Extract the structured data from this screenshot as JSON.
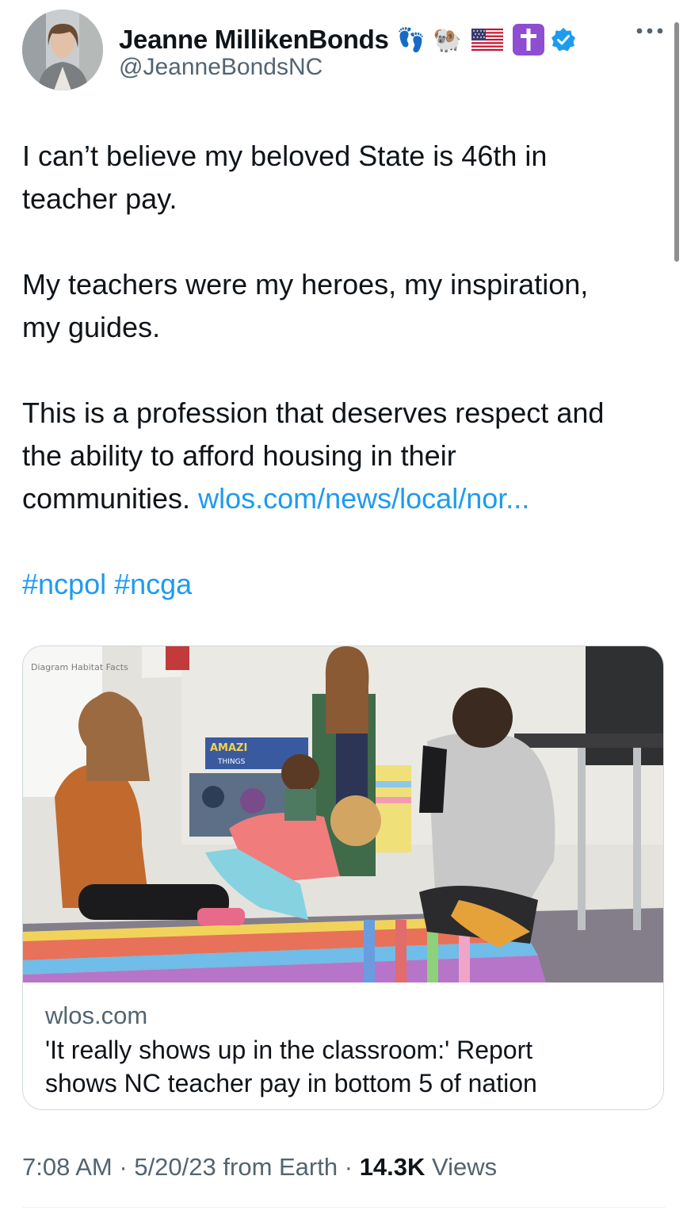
{
  "author": {
    "display_name": "Jeanne MillikenBonds",
    "handle": "@JeanneBondsNC",
    "badges": [
      "footprints-icon",
      "ram-icon",
      "us-flag-icon",
      "latin-cross-icon",
      "verified-badge-icon"
    ]
  },
  "tweet": {
    "line1": "I can’t believe my beloved State is 46th in",
    "line2": "teacher pay.",
    "line3": "My teachers were my heroes, my inspiration,",
    "line4": "my guides.",
    "line5": "This is a profession that deserves respect and",
    "line6": "the ability to afford housing in their",
    "line7": "communities.",
    "link": "wlos.com/news/local/nor...",
    "hashtag1": "#ncpol",
    "hashtag2": "#ncga"
  },
  "card": {
    "image_signs": {
      "board": "Diagram Habitat Facts",
      "banner_top": "AMAZI",
      "banner_bottom": "THINGS"
    },
    "domain": "wlos.com",
    "title_line1": "'It really shows up in the classroom:' Report",
    "title_line2": "shows NC teacher pay in bottom 5 of nation"
  },
  "meta": {
    "time": "7:08 AM",
    "sep1": "·",
    "date": "5/20/23",
    "source": "from Earth",
    "sep2": "·",
    "views_count": "14.3K",
    "views_label": "Views"
  },
  "colors": {
    "link": "#1d9bf0",
    "secondary_text": "#536471",
    "verified": "#1d9bf0",
    "cross_badge": "#8f4dd1"
  }
}
